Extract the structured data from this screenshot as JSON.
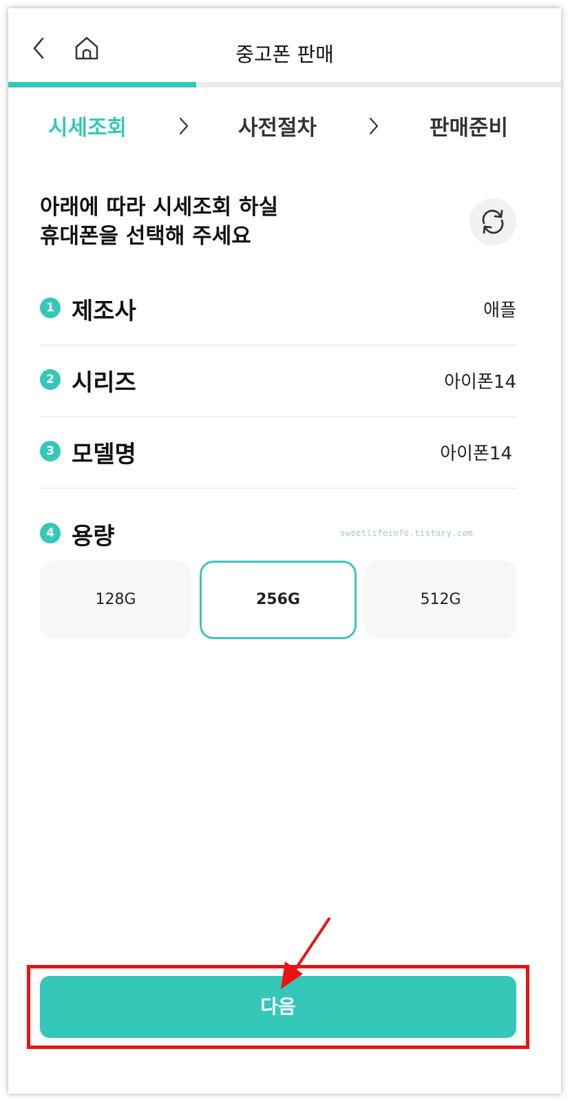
{
  "header": {
    "title": "중고폰 판매",
    "back_icon": "chevron-left-icon",
    "home_icon": "home-icon",
    "progress": 0.34,
    "accent_color": "#35c7b8"
  },
  "steps": [
    {
      "label": "시세조회",
      "active": true
    },
    {
      "label": "사전절차",
      "active": false
    },
    {
      "label": "판매준비",
      "active": false
    }
  ],
  "heading": {
    "line1": "아래에 따라 시세조회 하실",
    "line2": "휴대폰을 선택해 주세요",
    "refresh_icon": "refresh-icon"
  },
  "fields": [
    {
      "num": "1",
      "label": "제조사",
      "value": "애플"
    },
    {
      "num": "2",
      "label": "시리즈",
      "value": "아이폰14"
    },
    {
      "num": "3",
      "label": "모델명",
      "value": "아이폰14"
    }
  ],
  "capacity": {
    "num": "4",
    "label": "용량",
    "options": [
      "128G",
      "256G",
      "512G"
    ],
    "selected": "256G"
  },
  "watermark": "sweetlifeinfo.tistory.com",
  "next_button": {
    "label": "다음"
  },
  "annotation": {
    "box_color": "#ee1111",
    "arrow_color": "#ee1111"
  }
}
